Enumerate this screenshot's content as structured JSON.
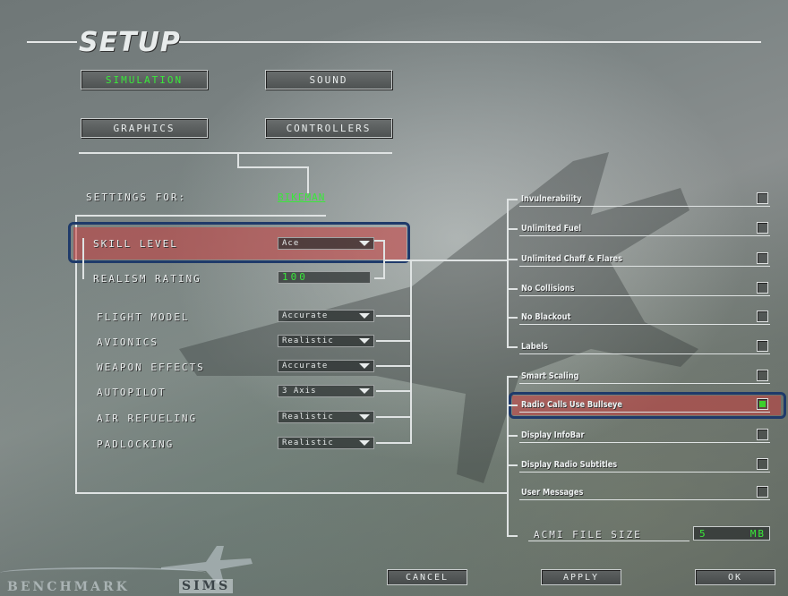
{
  "header": {
    "title": "SETUP"
  },
  "tabs": [
    {
      "label": "Simulation",
      "active": true
    },
    {
      "label": "Sound",
      "active": false
    },
    {
      "label": "Graphics",
      "active": false
    },
    {
      "label": "Controllers",
      "active": false
    }
  ],
  "settings_for": {
    "label": "Settings For:",
    "pilot": "Bikeman"
  },
  "skill": {
    "label": "Skill Level",
    "value": "Ace"
  },
  "realism": {
    "label": "Realism Rating",
    "value": "100"
  },
  "params": [
    {
      "label": "Flight Model",
      "value": "Accurate"
    },
    {
      "label": "Avionics",
      "value": "Realistic"
    },
    {
      "label": "Weapon Effects",
      "value": "Accurate"
    },
    {
      "label": "Autopilot",
      "value": "3 Axis"
    },
    {
      "label": "Air Refueling",
      "value": "Realistic"
    },
    {
      "label": "Padlocking",
      "value": "Realistic"
    }
  ],
  "options": [
    {
      "label": "Invulnerability",
      "checked": false
    },
    {
      "label": "Unlimited Fuel",
      "checked": false
    },
    {
      "label": "Unlimited Chaff & Flares",
      "checked": false
    },
    {
      "label": "No Collisions",
      "checked": false
    },
    {
      "label": "No Blackout",
      "checked": false
    },
    {
      "label": "Labels",
      "checked": false
    },
    {
      "label": "Smart Scaling",
      "checked": false
    },
    {
      "label": "Radio Calls Use Bullseye",
      "checked": true
    },
    {
      "label": "Display InfoBar",
      "checked": false
    },
    {
      "label": "Display Radio Subtitles",
      "checked": false
    },
    {
      "label": "User Messages",
      "checked": false
    }
  ],
  "acmi": {
    "label": "ACMI File Size",
    "value": "5",
    "unit": "MB"
  },
  "buttons": {
    "cancel": "Cancel",
    "apply": "Apply",
    "ok": "OK"
  },
  "logo": {
    "text1": "BENCHMARK",
    "text2": "SIMS"
  },
  "colors": {
    "accent_green": "#39e93a",
    "highlight_red": "#c83c3c",
    "highlight_border": "#1f3a6a"
  }
}
